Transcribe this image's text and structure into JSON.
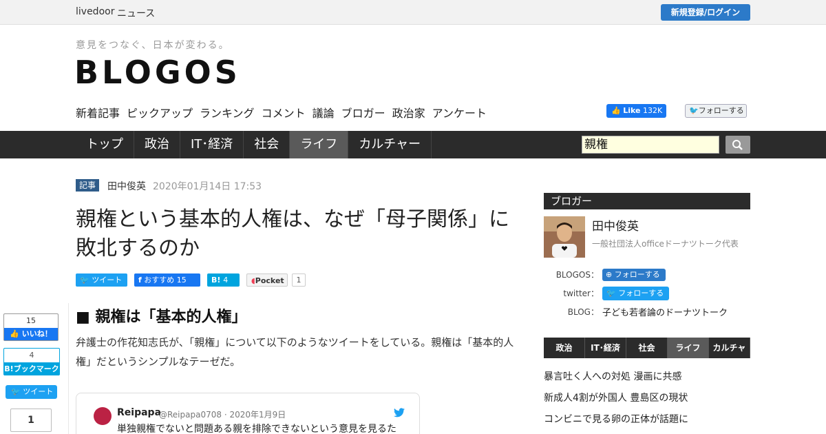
{
  "topbar": {
    "brand": "livedoor",
    "news": "ニュース",
    "login": "新規登録/ログイン"
  },
  "header": {
    "tagline": "意見をつなぐ、日本が変わる。",
    "logo": "BLOGOS",
    "subnav": [
      "新着記事",
      "ピックアップ",
      "ランキング",
      "コメント",
      "議論",
      "ブロガー",
      "政治家",
      "アンケート"
    ],
    "fb_like": "Like",
    "fb_like_count": "132K",
    "twitter_follow": "フォローする"
  },
  "nav": {
    "items": [
      "トップ",
      "政治",
      "IT･経済",
      "社会",
      "ライフ",
      "カルチャー"
    ],
    "active": "ライフ",
    "search_value": "親権"
  },
  "article": {
    "tag": "記事",
    "author": "田中俊英",
    "date": "2020年01月14日 17:53",
    "title": "親権という基本的人権は、なぜ「母子関係」に敗北するのか",
    "share": {
      "tweet": "ツイート",
      "fb": "おすすめ",
      "fb_count": "15",
      "hatena": "B!",
      "hatena_count": "4",
      "pocket": "Pocket",
      "pocket_count": "1"
    },
    "section_heading": "■ 親権は「基本的人権」",
    "body": "弁護士の作花知志氏が、「親権」について以下のようなツイートをしている。親権は「基本的人権」だというシンプルなテーゼだ。",
    "tweet": {
      "name": "Reipapa",
      "handle": "@Reipapa0708",
      "sep": "·",
      "date": "2020年1月9日",
      "text": "単独親権でないと問題ある親を排除できないという意見を見るた"
    }
  },
  "floating_share": {
    "fb_count": "15",
    "fb_label": "いいね！",
    "hatena_count": "4",
    "hatena_label": "B!ブックマーク",
    "tweet_label": "ツイート",
    "pocket_count": "1"
  },
  "sidebar": {
    "heading": "ブロガー",
    "blogger_name": "田中俊英",
    "blogger_desc": "一般社団法人officeドーナツトーク代表",
    "label_blogos": "BLOGOS：",
    "label_twitter": "twitter：",
    "label_blog": "BLOG：",
    "follow_blogos": "フォローする",
    "follow_twitter": "フォローする",
    "blog_name": "子ども若者論のドーナツトーク",
    "tabs": [
      "政治",
      "IT･経済",
      "社会",
      "ライフ",
      "カルチャー"
    ],
    "active_tab": "ライフ",
    "news": [
      "暴言吐く人への対処 漫画に共感",
      "新成人4割が外国人 豊島区の現状",
      "コンビニで見る卵の正体が話題に"
    ]
  },
  "colors": {
    "nav_bg": "#2b2b2b",
    "accent": "#2c7ac9",
    "twitter": "#1da1f2",
    "facebook": "#1877f2",
    "hatena": "#00a4de"
  }
}
